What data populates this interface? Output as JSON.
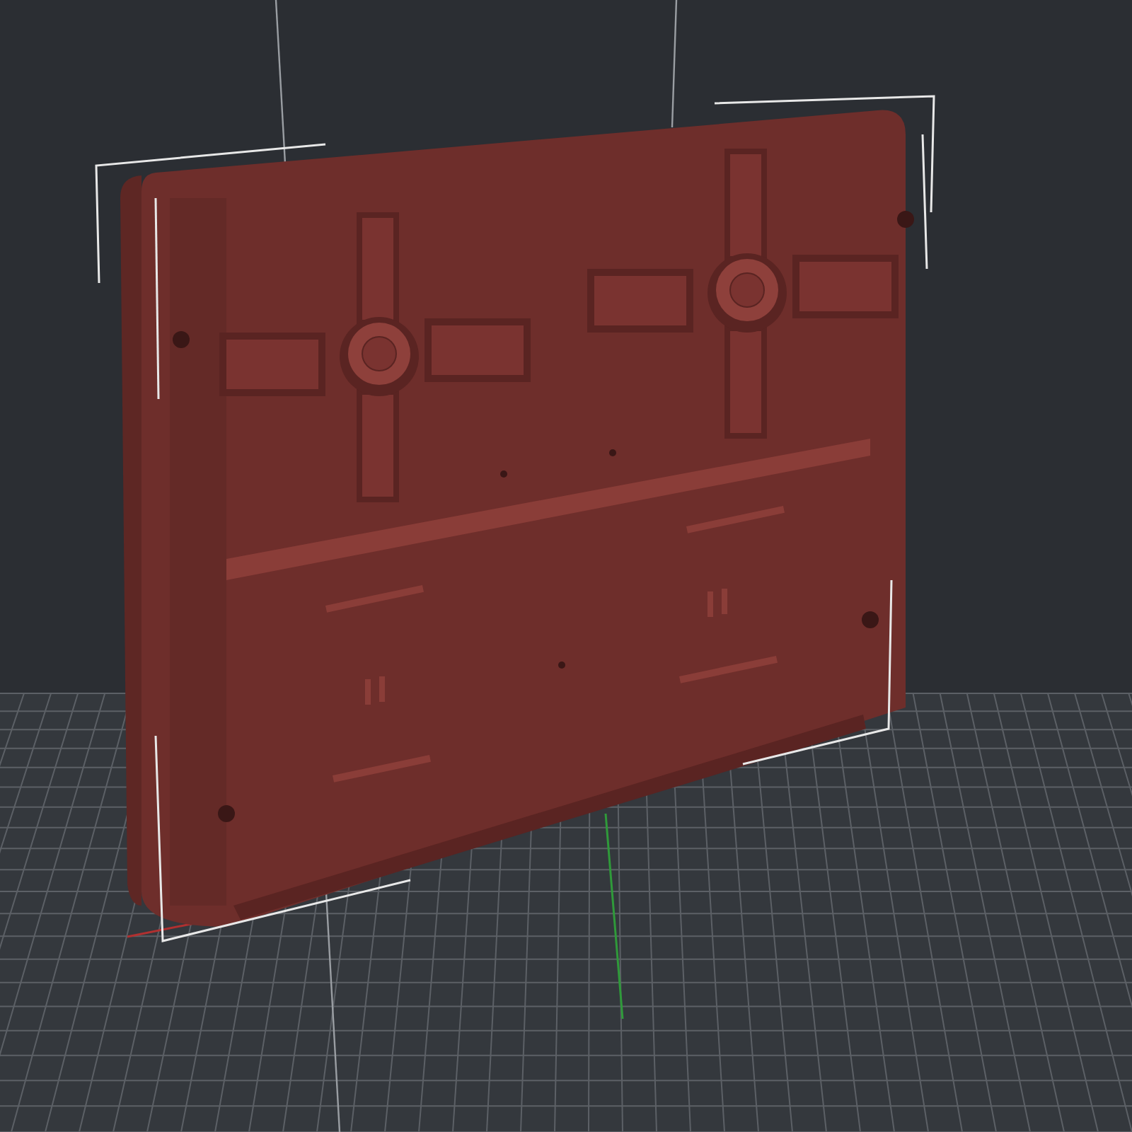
{
  "viewport": {
    "model_selected": true
  }
}
